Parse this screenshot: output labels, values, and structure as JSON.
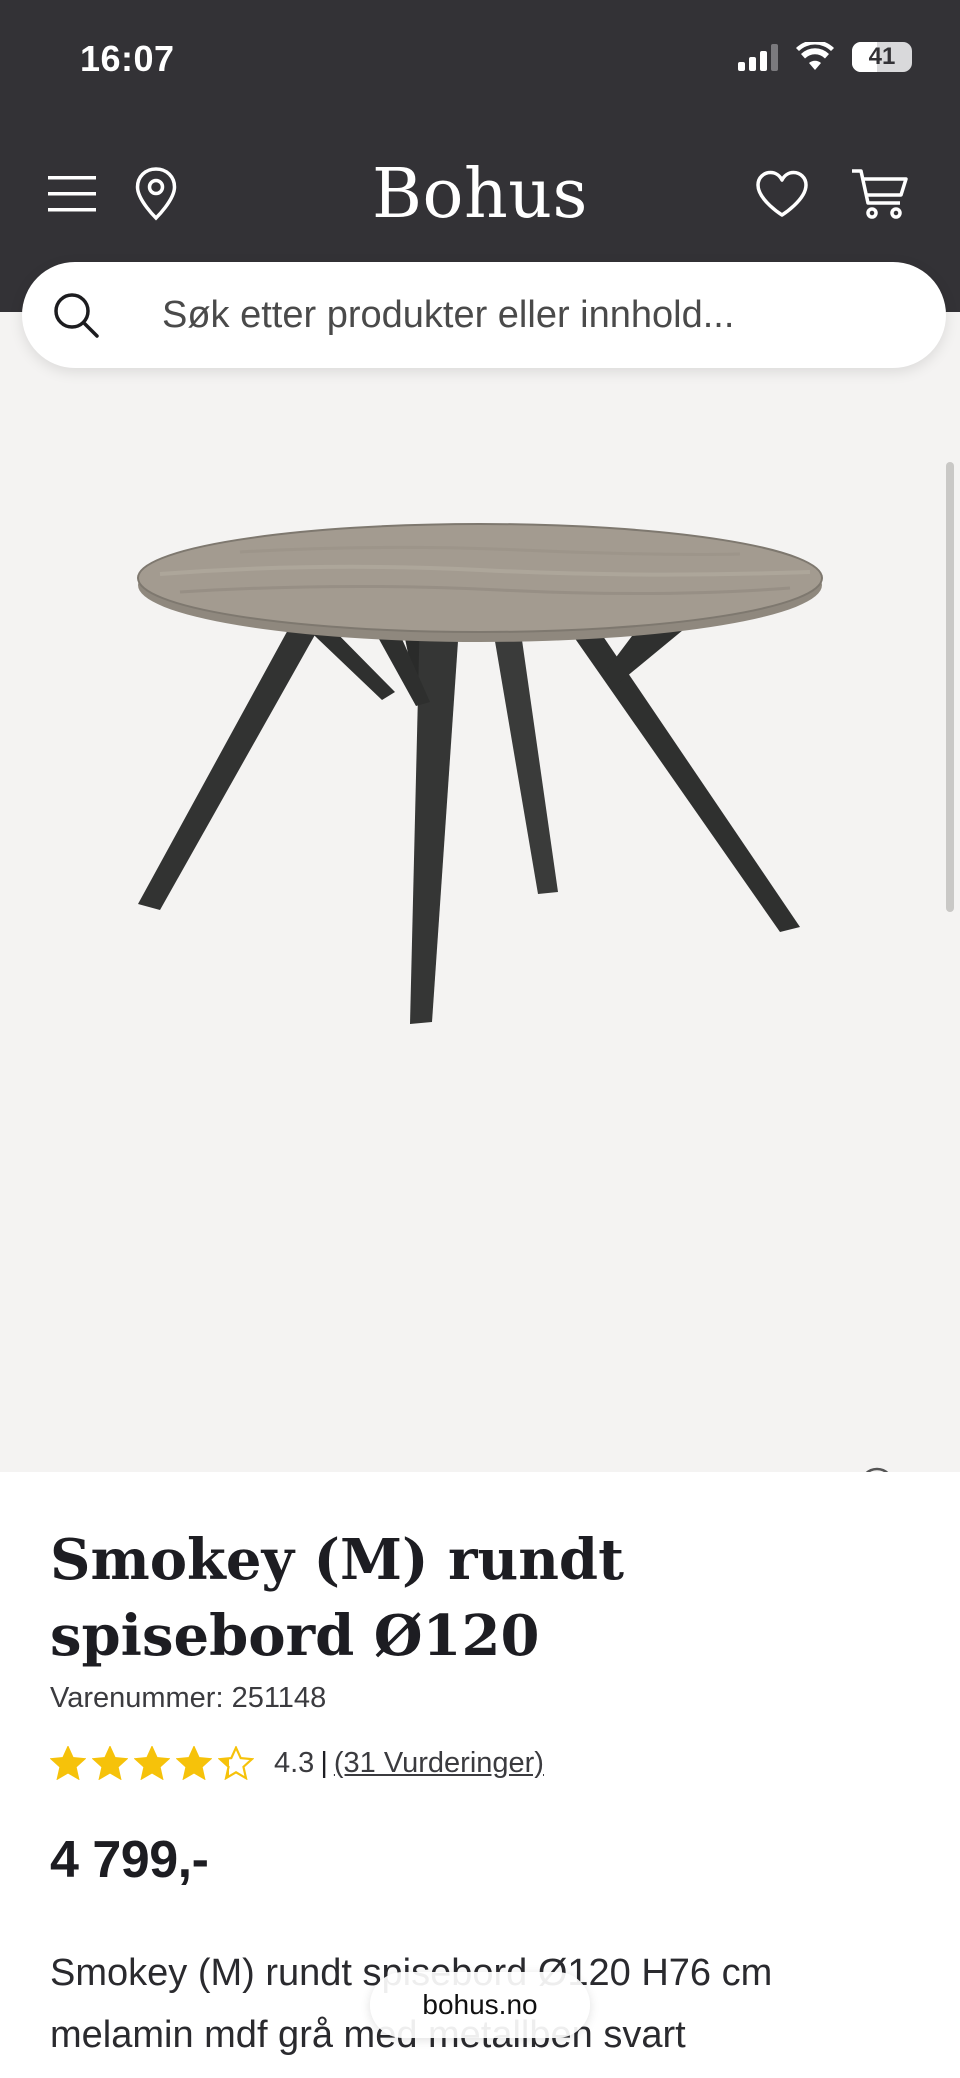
{
  "status_bar": {
    "time": "16:07",
    "battery": "41",
    "battery_level": 0.41
  },
  "header": {
    "logo": "Bohus",
    "menu_icon": "menu-icon",
    "location_icon": "location-pin-icon",
    "wishlist_icon": "heart-icon",
    "cart_icon": "cart-icon",
    "background": "#333236"
  },
  "search": {
    "placeholder": "Søk etter produkter eller innhold..."
  },
  "gallery": {
    "thumbnail_count": 6,
    "active_thumbnail": 0,
    "zoom_icon": "zoom-in-icon"
  },
  "product": {
    "title": "Smokey (M) rundt spisebord Ø120",
    "sku": "Varenummer: 251148",
    "rating": 4.3,
    "rating_value": "4.3",
    "rating_separator": "|",
    "rating_count": "(31 Vurderinger)",
    "price": "4 799,-",
    "description": "Smokey (M) rundt spisebord Ø120 H76 cm melamin mdf grå med metallben svart"
  },
  "browser": {
    "url": "bohus.no"
  },
  "colors": {
    "star": "#f6c20a",
    "star_empty": "#d8d8d8",
    "text": "#1d1d22",
    "gallery_bg": "#f4f3f2"
  }
}
